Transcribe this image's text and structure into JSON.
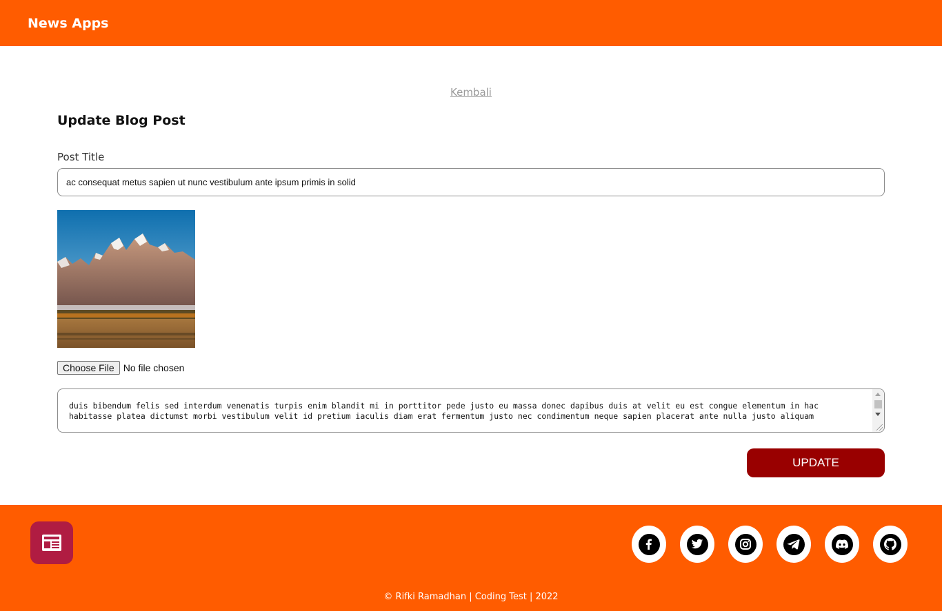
{
  "navbar": {
    "brand": "News Apps"
  },
  "back_link": "Kembali",
  "form": {
    "heading": "Update Blog Post",
    "title_label": "Post Title",
    "title_value": "ac consequat metus sapien ut nunc vestibulum ante ipsum primis in solid",
    "file_button": "Choose File",
    "file_status": "No file chosen",
    "body_value": "duis bibendum felis sed interdum venenatis turpis enim blandit mi in porttitor pede justo eu massa donec dapibus duis at velit eu est congue elementum in hac habitasse platea dictumst morbi vestibulum velit id pretium iaculis diam erat fermentum justo nec condimentum neque sapien placerat ante nulla justo aliquam",
    "submit_label": "UPDATE"
  },
  "footer": {
    "copyright": "© Rifki Ramadhan | Coding Test | 2022",
    "socials": [
      "facebook-icon",
      "twitter-icon",
      "instagram-icon",
      "telegram-icon",
      "discord-icon",
      "github-icon"
    ]
  },
  "colors": {
    "primary": "#ff5c00",
    "button": "#990000",
    "logo_bg": "#b01c42"
  }
}
